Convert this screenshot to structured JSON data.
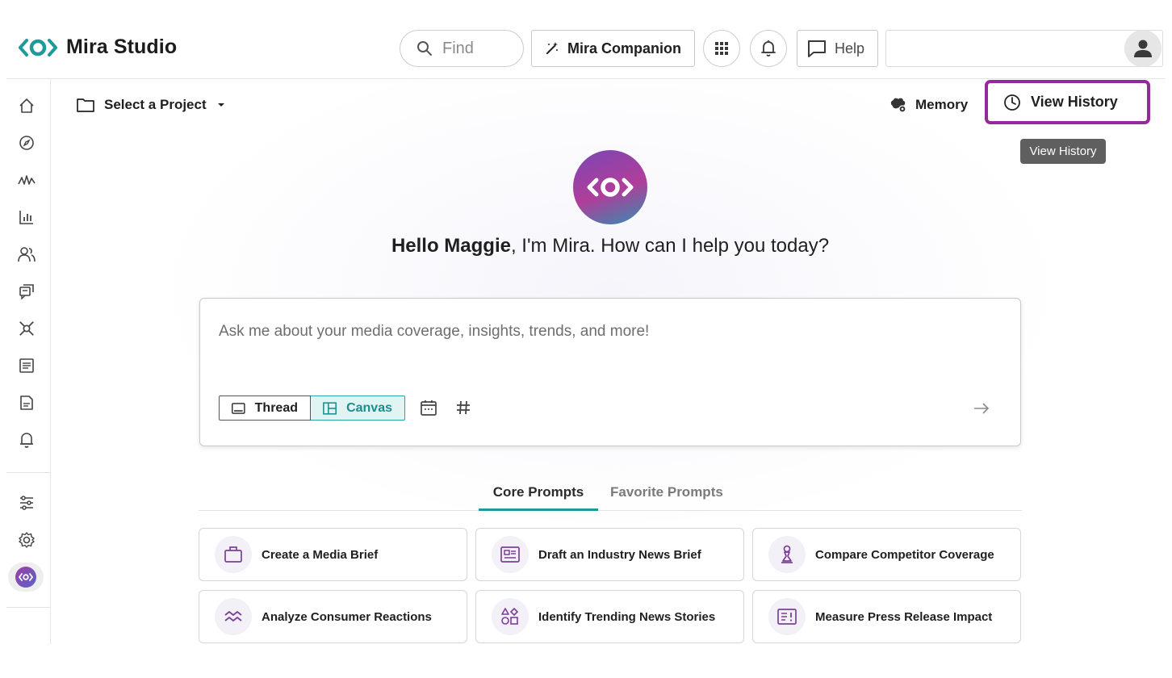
{
  "app": {
    "name": "Mira Studio",
    "accent_color": "#1e9a9a",
    "brand_purple": "#93299a"
  },
  "topbar": {
    "search_placeholder": "Find",
    "companion_label": "Mira Companion",
    "help_label": "Help"
  },
  "sidebar": {
    "items": [
      {
        "icon": "home-icon"
      },
      {
        "icon": "compass-icon"
      },
      {
        "icon": "activity-icon"
      },
      {
        "icon": "bar-chart-icon"
      },
      {
        "icon": "people-icon"
      },
      {
        "icon": "chat-icon"
      },
      {
        "icon": "network-icon"
      },
      {
        "icon": "newsletter-icon"
      },
      {
        "icon": "report-icon"
      },
      {
        "icon": "bell-icon"
      }
    ],
    "bottom_items": [
      {
        "icon": "sliders-icon"
      },
      {
        "icon": "settings-icon"
      },
      {
        "icon": "mira-logo-icon"
      }
    ]
  },
  "main": {
    "project_label": "Select a Project",
    "memory_label": "Memory",
    "view_history_label": "View History",
    "tooltip": "View History",
    "greeting_name": "Hello Maggie",
    "greeting_rest": ", I'm Mira. How can I help you today?",
    "composer": {
      "placeholder": "Ask me about your media coverage, insights, trends, and more!",
      "thread_label": "Thread",
      "canvas_label": "Canvas",
      "selected_mode": "Canvas"
    },
    "tabs": [
      {
        "label": "Core Prompts",
        "active": true
      },
      {
        "label": "Favorite Prompts",
        "active": false
      }
    ],
    "prompts": [
      {
        "label": "Create a Media Brief",
        "icon": "briefcase-icon"
      },
      {
        "label": "Draft an Industry News Brief",
        "icon": "newspaper-icon"
      },
      {
        "label": "Compare Competitor Coverage",
        "icon": "chess-icon"
      },
      {
        "label": "Analyze Consumer Reactions",
        "icon": "trend-wave-icon"
      },
      {
        "label": "Identify Trending News Stories",
        "icon": "shapes-icon"
      },
      {
        "label": "Measure Press Release Impact",
        "icon": "press-release-icon"
      }
    ]
  }
}
